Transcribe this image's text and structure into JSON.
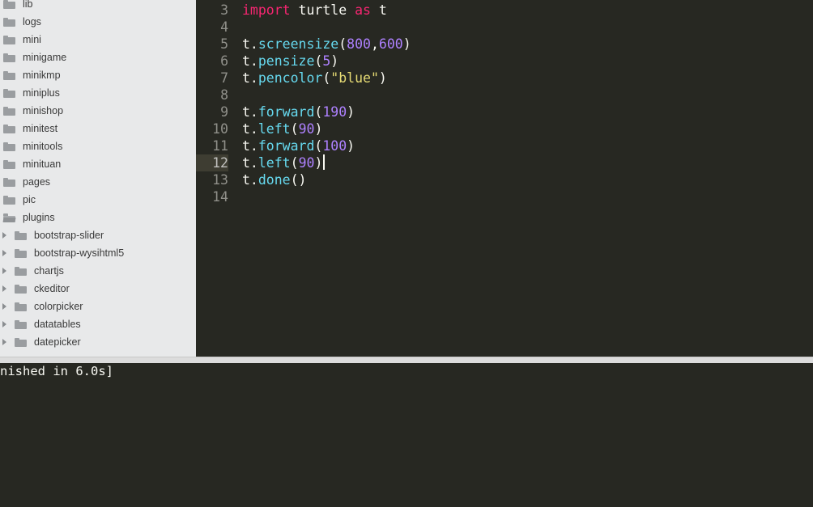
{
  "sidebar": {
    "items": [
      {
        "label": "lib",
        "type": "folder"
      },
      {
        "label": "logs",
        "type": "folder"
      },
      {
        "label": "mini",
        "type": "folder"
      },
      {
        "label": "minigame",
        "type": "folder"
      },
      {
        "label": "minikmp",
        "type": "folder"
      },
      {
        "label": "miniplus",
        "type": "folder"
      },
      {
        "label": "minishop",
        "type": "folder"
      },
      {
        "label": "minitest",
        "type": "folder"
      },
      {
        "label": "minitools",
        "type": "folder"
      },
      {
        "label": "minituan",
        "type": "folder"
      },
      {
        "label": "pages",
        "type": "folder"
      },
      {
        "label": "pic",
        "type": "folder"
      },
      {
        "label": "plugins",
        "type": "folder-open"
      },
      {
        "label": "bootstrap-slider",
        "type": "subfolder"
      },
      {
        "label": "bootstrap-wysihtml5",
        "type": "subfolder"
      },
      {
        "label": "chartjs",
        "type": "subfolder"
      },
      {
        "label": "ckeditor",
        "type": "subfolder"
      },
      {
        "label": "colorpicker",
        "type": "subfolder"
      },
      {
        "label": "datatables",
        "type": "subfolder"
      },
      {
        "label": "datepicker",
        "type": "subfolder"
      }
    ]
  },
  "editor": {
    "lines": [
      {
        "num": "3"
      },
      {
        "num": "4"
      },
      {
        "num": "5"
      },
      {
        "num": "6"
      },
      {
        "num": "7"
      },
      {
        "num": "8"
      },
      {
        "num": "9"
      },
      {
        "num": "10"
      },
      {
        "num": "11"
      },
      {
        "num": "12"
      },
      {
        "num": "13"
      },
      {
        "num": "14"
      }
    ],
    "tokens": {
      "l3_kw1": "import",
      "l3_mod": " turtle ",
      "l3_kw2": "as",
      "l3_alias": " t",
      "l5_obj": "t.",
      "l5_fn": "screensize",
      "l5_open": "(",
      "l5_n1": "800",
      "l5_comma": ",",
      "l5_n2": "600",
      "l5_close": ")",
      "l6_obj": "t.",
      "l6_fn": "pensize",
      "l6_open": "(",
      "l6_n": "5",
      "l6_close": ")",
      "l7_obj": "t.",
      "l7_fn": "pencolor",
      "l7_open": "(",
      "l7_s": "\"blue\"",
      "l7_close": ")",
      "l9_obj": "t.",
      "l9_fn": "forward",
      "l9_open": "(",
      "l9_n": "190",
      "l9_close": ")",
      "l10_obj": "t.",
      "l10_fn": "left",
      "l10_open": "(",
      "l10_n": "90",
      "l10_close": ")",
      "l11_obj": "t.",
      "l11_fn": "forward",
      "l11_open": "(",
      "l11_n": "100",
      "l11_close": ")",
      "l12_obj": "t.",
      "l12_fn": "left",
      "l12_open": "(",
      "l12_n": "90",
      "l12_close": ")",
      "l13_obj": "t.",
      "l13_fn": "done",
      "l13_paren": "()"
    }
  },
  "console": {
    "output": "nished in 6.0s]"
  },
  "colors": {
    "editor_bg": "#272822",
    "sidebar_bg": "#e8e9ea",
    "keyword": "#f92672",
    "function": "#66d9ef",
    "number": "#ae81ff",
    "string": "#e6db74"
  }
}
